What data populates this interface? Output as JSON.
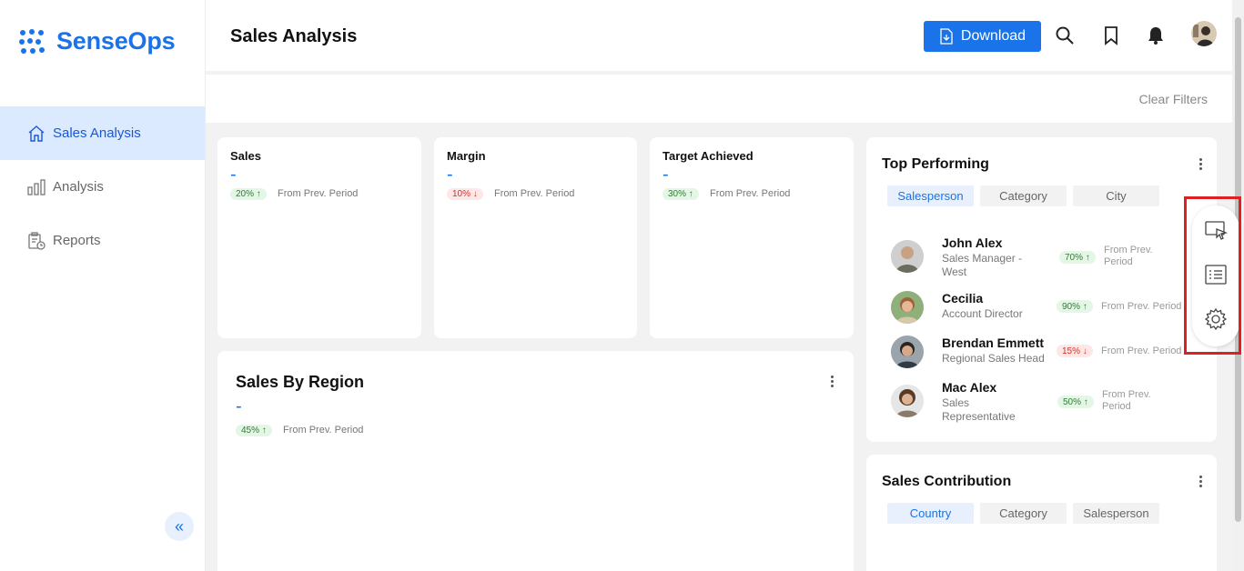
{
  "brand": {
    "name": "SenseOps",
    "color": "#1a73e8"
  },
  "sidebar": {
    "items": [
      {
        "label": "Sales Analysis",
        "icon": "home-icon",
        "active": true
      },
      {
        "label": "Analysis",
        "icon": "bar-chart-icon",
        "active": false
      },
      {
        "label": "Reports",
        "icon": "clipboard-report-icon",
        "active": false
      }
    ],
    "collapse_label": "«"
  },
  "header": {
    "title": "Sales Analysis",
    "download_label": "Download"
  },
  "filters": {
    "clear_label": "Clear Filters"
  },
  "kpis": [
    {
      "title": "Sales",
      "value": "-",
      "change": "20%",
      "direction": "up",
      "note": "From Prev. Period"
    },
    {
      "title": "Margin",
      "value": "-",
      "change": "10%",
      "direction": "down",
      "note": "From Prev. Period"
    },
    {
      "title": "Target Achieved",
      "value": "-",
      "change": "30%",
      "direction": "up",
      "note": "From Prev. Period"
    }
  ],
  "sales_by_region": {
    "title": "Sales By Region",
    "value": "-",
    "change": "45%",
    "direction": "up",
    "note": "From Prev. Period"
  },
  "top_performing": {
    "title": "Top Performing",
    "tabs": [
      "Salesperson",
      "Category",
      "City"
    ],
    "active_tab": "Salesperson",
    "people": [
      {
        "name": "John Alex",
        "role": "Sales Manager - West",
        "change": "70%",
        "direction": "up",
        "note": "From Prev. Period"
      },
      {
        "name": "Cecilia",
        "role": "Account Director",
        "change": "90%",
        "direction": "up",
        "note": "From Prev. Period"
      },
      {
        "name": "Brendan Emmett",
        "role": "Regional Sales Head",
        "change": "15%",
        "direction": "down",
        "note": "From Prev. Period"
      },
      {
        "name": "Mac Alex",
        "role": "Sales Representative",
        "change": "50%",
        "direction": "up",
        "note": "From Prev. Period"
      }
    ]
  },
  "sales_contribution": {
    "title": "Sales Contribution",
    "tabs": [
      "Country",
      "Category",
      "Salesperson"
    ],
    "active_tab": "Country"
  },
  "float_toolbar": {
    "icons": [
      "screen-pointer-icon",
      "list-icon",
      "gear-icon"
    ]
  },
  "colors": {
    "accent": "#1a73e8",
    "up": "#2e7d32",
    "down": "#d93025",
    "highlight": "#e02020"
  }
}
